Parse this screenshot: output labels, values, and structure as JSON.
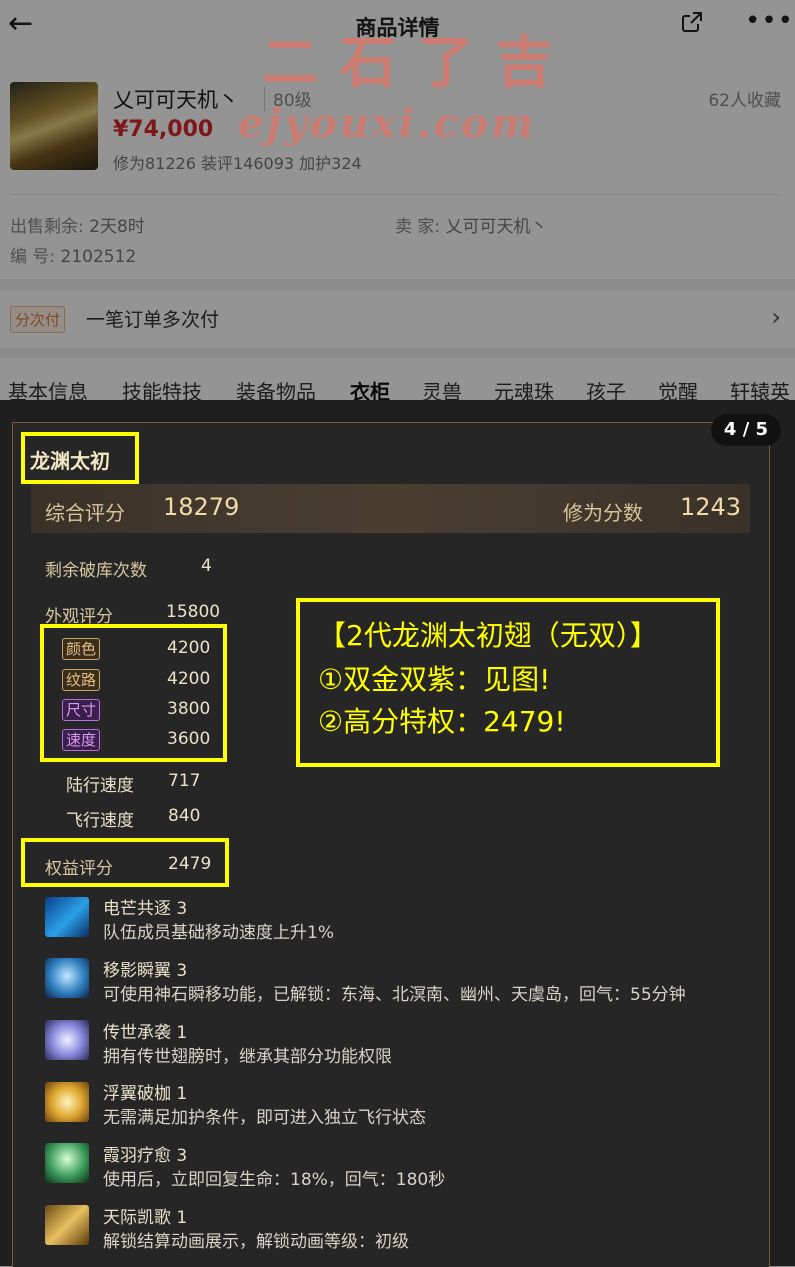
{
  "header": {
    "back_icon": "back-arrow-icon",
    "title": "商品详情",
    "share_icon": "share-icon",
    "more_icon": "more-icon"
  },
  "watermark": {
    "line1": "二石了吉",
    "line2": "ejyouxi.com"
  },
  "product": {
    "name": "乂可可天机丶",
    "level": "80级",
    "favorites": "62人收藏",
    "price": "¥74,000",
    "stats": "修为81226 装评146093 加护324"
  },
  "info": {
    "sale_left_label": "出售剩余:",
    "sale_left_value": "2天8时",
    "seller_label": "卖 家:",
    "seller_value": "乂可可天机丶",
    "id_label": "编 号:",
    "id_value": "2102512"
  },
  "payment": {
    "tag": "分次付",
    "text": "一笔订单多次付"
  },
  "tabs": [
    "基本信息",
    "技能特技",
    "装备物品",
    "衣柜",
    "灵兽",
    "元魂珠",
    "孩子",
    "觉醒",
    "轩辕英"
  ],
  "active_tab": "衣柜",
  "card": {
    "counter": "4 / 5",
    "title": "龙渊太初",
    "overall_label": "综合评分",
    "overall_value": "18279",
    "cultivation_label": "修为分数",
    "cultivation_value": "1243",
    "break_label": "剩余破库次数",
    "break_value": "4",
    "appearance_label": "外观评分",
    "appearance_value": "15800",
    "attributes": [
      {
        "label": "颜色",
        "value": "4200",
        "color": "gold"
      },
      {
        "label": "纹路",
        "value": "4200",
        "color": "gold"
      },
      {
        "label": "尺寸",
        "value": "3800",
        "color": "purple"
      },
      {
        "label": "速度",
        "value": "3600",
        "color": "purple"
      }
    ],
    "land_speed_label": "陆行速度",
    "land_speed_value": "717",
    "fly_speed_label": "飞行速度",
    "fly_speed_value": "840",
    "benefit_label": "权益评分",
    "benefit_value": "2479"
  },
  "callout": {
    "line1": "【2代龙渊太初翅（无双）】",
    "line2": "①双金双紫：见图!",
    "line3": "②高分特权：2479!"
  },
  "skills": [
    {
      "name": "电芒共逐 3",
      "desc": "队伍成员基础移动速度上升1%",
      "icon": "lightning-runner-icon"
    },
    {
      "name": "移影瞬翼 3",
      "desc": "可使用神石瞬移功能，已解锁：东海、北溟南、幽州、天虞岛，回气：55分钟",
      "icon": "teleport-icon"
    },
    {
      "name": "传世承袭 1",
      "desc": "拥有传世翅膀时，继承其部分功能权限",
      "icon": "heritage-wings-icon"
    },
    {
      "name": "浮翼破枷 1",
      "desc": "无需满足加护条件，即可进入独立飞行状态",
      "icon": "golden-wings-icon"
    },
    {
      "name": "霞羽疗愈 3",
      "desc": "使用后，立即回复生命：18%，回气：180秒",
      "icon": "healing-figure-icon"
    },
    {
      "name": "天际凯歌 1",
      "desc": "解锁结算动画展示，解锁动画等级：初级",
      "icon": "victory-animation-icon"
    }
  ]
}
